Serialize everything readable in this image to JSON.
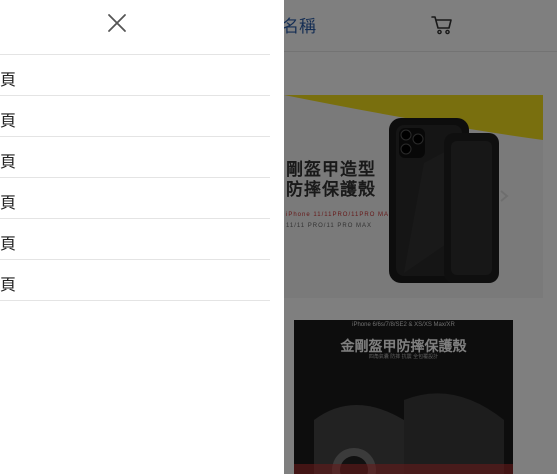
{
  "header": {
    "store_name": "名稱"
  },
  "icons": {
    "close": "close-icon",
    "cart": "cart-icon",
    "arrow": "chevron-right-icon"
  },
  "drawer": {
    "items": [
      {
        "label": "首頁"
      },
      {
        "label": "首頁"
      },
      {
        "label": "首頁"
      },
      {
        "label": "首頁"
      },
      {
        "label": "首頁"
      },
      {
        "label": "首頁"
      }
    ]
  },
  "banner": {
    "line1": "剛盔甲造型",
    "line2": "防摔保護殼",
    "line3": "11/11 PRO/11 PRO MAX",
    "line4": "iPhone 11/11PRO/11PRO MAX"
  },
  "product": {
    "subtitle": "iPhone 6/6s/7/8/SE2 & XS/XS Max/XR",
    "title": "金剛盔甲防摔保護殼",
    "description": "四角氣囊 防摔 抗震 全包覆設計"
  },
  "colors": {
    "store_name": "#2b5ca8",
    "overlay": "rgba(0,0,0,0.5)",
    "drawer_bg": "#ffffff",
    "divider": "#e4e4e4"
  }
}
